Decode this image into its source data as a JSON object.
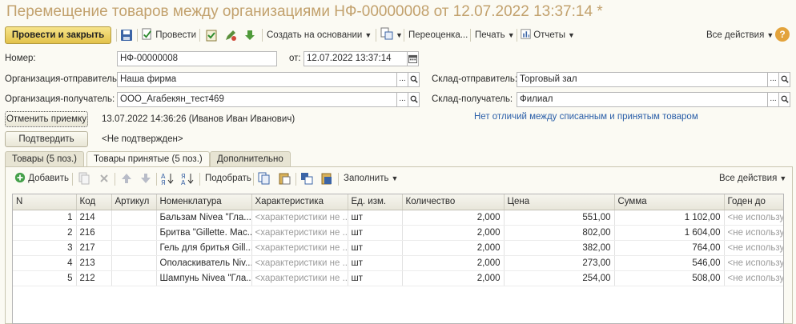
{
  "title": "Перемещение товаров между организациями НФ-00000008 от 12.07.2022 13:37:14 *",
  "toolbar": {
    "post_close": "Провести и закрыть",
    "post": "Провести",
    "create_based_on": "Создать на основании",
    "revaluation": "Переоценка...",
    "print": "Печать",
    "reports": "Отчеты",
    "all_actions": "Все действия",
    "help": "?"
  },
  "form": {
    "number_label": "Номер:",
    "number_value": "НФ-00000008",
    "date_label": "от:",
    "date_value": "12.07.2022 13:37:14",
    "org_sender_label": "Организация-отправитель:",
    "org_sender_value": "Наша фирма",
    "org_receiver_label": "Организация-получатель:",
    "org_receiver_value": "ООО_Агабекян_тест469",
    "wh_sender_label": "Склад-отправитель:",
    "wh_sender_value": "Торговый зал",
    "wh_receiver_label": "Склад-получатель:",
    "wh_receiver_value": "Филиал",
    "cancel_receipt": "Отменить приемку",
    "receipt_info": "13.07.2022 14:36:26 (Иванов Иван Иванович)",
    "no_diff_link": "Нет отличий между списанным и принятым товаром",
    "confirm": "Подтвердить",
    "not_confirmed": "<Не подтвержден>"
  },
  "tabs": [
    {
      "label": "Товары (5 поз.)"
    },
    {
      "label": "Товары принятые (5 поз.)"
    },
    {
      "label": "Дополнительно"
    }
  ],
  "table_toolbar": {
    "add": "Добавить",
    "pick": "Подобрать",
    "fill": "Заполнить",
    "all_actions": "Все действия"
  },
  "columns": [
    "N",
    "Код",
    "Артикул",
    "Номенклатура",
    "Характеристика",
    "Ед. изм.",
    "Количество",
    "Цена",
    "Сумма",
    "Годен до"
  ],
  "rows": [
    {
      "n": "1",
      "code": "214",
      "article": "",
      "item": "Бальзам Nivea \"Гла...",
      "char": "<характеристики не ...",
      "unit": "шт",
      "qty": "2,000",
      "price": "551,00",
      "sum": "1 102,00",
      "exp": "<не используе"
    },
    {
      "n": "2",
      "code": "216",
      "article": "",
      "item": "Бритва \"Gillette. Mac...",
      "char": "<характеристики не ...",
      "unit": "шт",
      "qty": "2,000",
      "price": "802,00",
      "sum": "1 604,00",
      "exp": "<не используе"
    },
    {
      "n": "3",
      "code": "217",
      "article": "",
      "item": "Гель для бритья Gill...",
      "char": "<характеристики не ...",
      "unit": "шт",
      "qty": "2,000",
      "price": "382,00",
      "sum": "764,00",
      "exp": "<не используе"
    },
    {
      "n": "4",
      "code": "213",
      "article": "",
      "item": "Ополаскиватель Niv...",
      "char": "<характеристики не ...",
      "unit": "шт",
      "qty": "2,000",
      "price": "273,00",
      "sum": "546,00",
      "exp": "<не используе"
    },
    {
      "n": "5",
      "code": "212",
      "article": "",
      "item": "Шампунь Nivea \"Гла...",
      "char": "<характеристики не ...",
      "unit": "шт",
      "qty": "2,000",
      "price": "254,00",
      "sum": "508,00",
      "exp": "<не используе"
    }
  ]
}
